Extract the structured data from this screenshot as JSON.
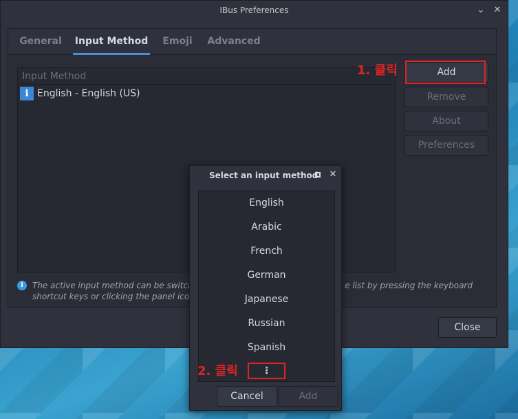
{
  "window": {
    "title": "IBus Preferences",
    "minimize_glyph": "⌄",
    "close_glyph": "✕"
  },
  "tabs": [
    {
      "label": "General",
      "active": false
    },
    {
      "label": "Input Method",
      "active": true
    },
    {
      "label": "Emoji",
      "active": false
    },
    {
      "label": "Advanced",
      "active": false
    }
  ],
  "input_list": {
    "header": "Input Method",
    "rows": [
      {
        "icon": "info-icon",
        "icon_glyph": "i",
        "label": "English - English (US)"
      }
    ]
  },
  "side_buttons": {
    "add": "Add",
    "remove": "Remove",
    "about": "About",
    "preferences": "Preferences"
  },
  "annotations": {
    "step1": "1. 클릭",
    "step2": "2. 클릭"
  },
  "hint": {
    "icon_glyph": "i",
    "text_left": "The active input method can be switched a",
    "text_right": "e list by pressing the keyboard",
    "text_line2": "shortcut keys or clicking the panel icon."
  },
  "close_button": "Close",
  "dialog": {
    "title": "Select an input method",
    "close_glyph": "✕",
    "languages": [
      "English",
      "Arabic",
      "French",
      "German",
      "Japanese",
      "Russian",
      "Spanish"
    ],
    "more_glyph": "⋮",
    "cancel": "Cancel",
    "add": "Add"
  },
  "colors": {
    "accent": "#4a90d9",
    "annotation_red": "#e02424",
    "window_bg": "#2f323c"
  }
}
